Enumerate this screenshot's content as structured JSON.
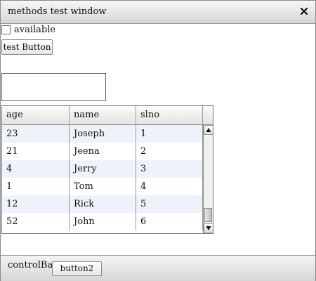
{
  "window": {
    "title": "methods test window",
    "close_icon": "close-icon"
  },
  "form": {
    "checkbox_label": "available",
    "checkbox_checked": false,
    "test_button_label": "test Button",
    "text_value": ""
  },
  "grid": {
    "columns": [
      "age",
      "name",
      "slno"
    ],
    "rows": [
      [
        "23",
        "Joseph",
        "1"
      ],
      [
        "21",
        "Jeena",
        "2"
      ],
      [
        "4",
        "Jerry",
        "3"
      ],
      [
        "1",
        "Tom",
        "4"
      ],
      [
        "12",
        "Rick",
        "5"
      ],
      [
        "52",
        "John",
        "6"
      ]
    ],
    "alt_row_color": "#eef3fb"
  },
  "control_bar": {
    "label": "controlBar",
    "button2_label": "button2"
  }
}
